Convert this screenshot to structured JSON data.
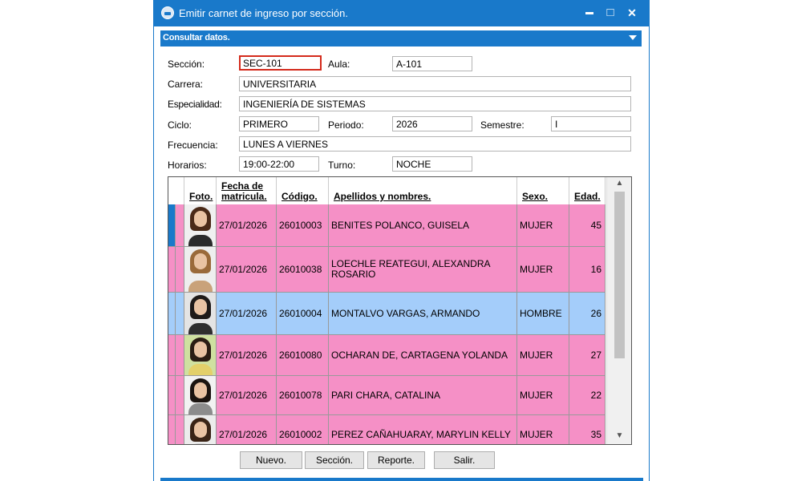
{
  "window": {
    "title": "Emitir carnet de ingreso por sección.",
    "controls": {
      "minimize": "▬",
      "maximize": "□",
      "close": "✕"
    }
  },
  "panel": {
    "title": "Consultar datos."
  },
  "form": {
    "seccion": {
      "label": "Sección:",
      "value": "SEC-101"
    },
    "aula": {
      "label": "Aula:",
      "value": "A-101"
    },
    "carrera": {
      "label": "Carrera:",
      "value": "UNIVERSITARIA"
    },
    "especialidad": {
      "label": "Especialidad:",
      "value": "INGENIERÍA DE SISTEMAS"
    },
    "ciclo": {
      "label": "Ciclo:",
      "value": "PRIMERO"
    },
    "periodo": {
      "label": "Periodo:",
      "value": "2026"
    },
    "semestre": {
      "label": "Semestre:",
      "value": "I"
    },
    "frecuencia": {
      "label": "Frecuencia:",
      "value": "LUNES A VIERNES"
    },
    "horarios": {
      "label": "Horarios:",
      "value": "19:00-22:00"
    },
    "turno": {
      "label": "Turno:",
      "value": "NOCHE"
    }
  },
  "grid": {
    "headers": {
      "foto": "Foto.",
      "fecha1": "Fecha de",
      "fecha2": "matricula.",
      "codigo": "Código.",
      "nombres": "Apellidos y nombres.",
      "sexo": "Sexo.",
      "edad": "Edad."
    },
    "rows": [
      {
        "fecha": "27/01/2026",
        "codigo": "26010003",
        "nombre": "BENITES POLANCO, GUISELA",
        "sexo": "MUJER",
        "edad": "45"
      },
      {
        "fecha": "27/01/2026",
        "codigo": "26010038",
        "nombre": "LOECHLE REATEGUI, ALEXANDRA ROSARIO",
        "sexo": "MUJER",
        "edad": "16"
      },
      {
        "fecha": "27/01/2026",
        "codigo": "26010004",
        "nombre": "MONTALVO VARGAS, ARMANDO",
        "sexo": "HOMBRE",
        "edad": "26"
      },
      {
        "fecha": "27/01/2026",
        "codigo": "26010080",
        "nombre": "OCHARAN DE, CARTAGENA YOLANDA",
        "sexo": "MUJER",
        "edad": "27"
      },
      {
        "fecha": "27/01/2026",
        "codigo": "26010078",
        "nombre": "PARI CHARA, CATALINA",
        "sexo": "MUJER",
        "edad": "22"
      },
      {
        "fecha": "27/01/2026",
        "codigo": "26010002",
        "nombre": "PEREZ CAÑAHUARAY, MARYLIN KELLY",
        "sexo": "MUJER",
        "edad": "35"
      }
    ]
  },
  "buttons": {
    "nuevo": "Nuevo.",
    "seccion": "Sección.",
    "reporte": "Reporte.",
    "salir": "Salir."
  },
  "colors": {
    "accent": "#1979ca",
    "row_female": "#f590c6",
    "row_male": "#a4cdfa",
    "field_active_border": "#d42a1b"
  }
}
